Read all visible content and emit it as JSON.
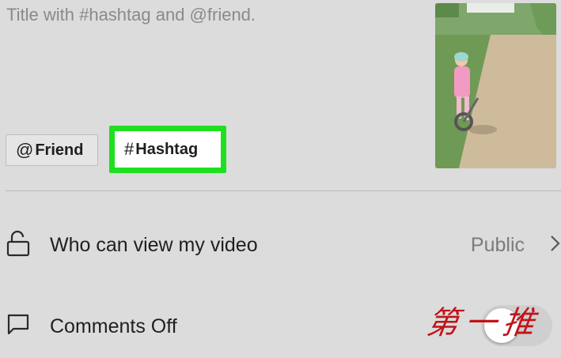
{
  "caption": {
    "placeholder": "Title with #hashtag and @friend."
  },
  "tags": {
    "friend": {
      "symbol": "@",
      "label": "Friend"
    },
    "hashtag": {
      "symbol": "#",
      "label": "Hashtag"
    }
  },
  "settings": [
    {
      "icon": "unlock-icon",
      "label": "Who can view my video",
      "value": "Public"
    },
    {
      "icon": "comment-icon",
      "label": "Comments Off",
      "toggle": false
    }
  ],
  "watermark": {
    "text": "第一推"
  },
  "colors": {
    "highlight": "#1fe01f",
    "watermark": "#c0141a"
  }
}
